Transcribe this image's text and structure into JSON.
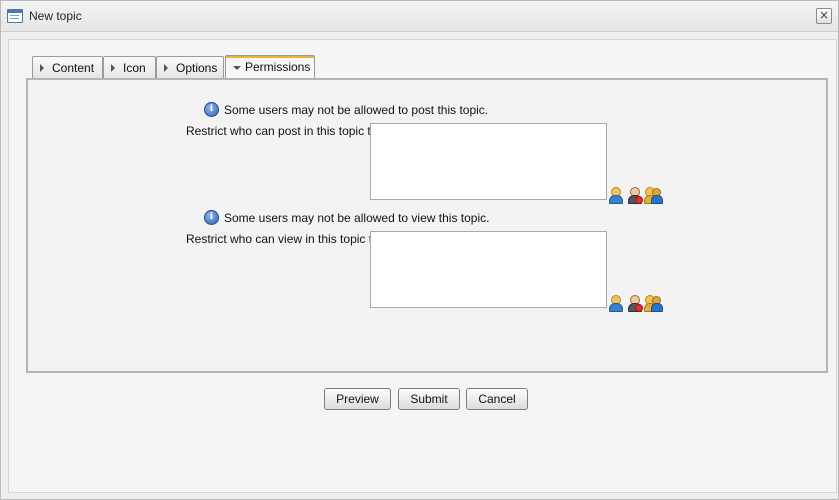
{
  "window": {
    "title": "New topic",
    "close_icon": "×"
  },
  "tabs": [
    {
      "label": "Content",
      "active": false
    },
    {
      "label": "Icon",
      "active": false
    },
    {
      "label": "Options",
      "active": false
    },
    {
      "label": "Permissions",
      "active": true
    }
  ],
  "permissions": {
    "post": {
      "info": "Some users may not be allowed to post this topic.",
      "label": "Restrict who can post in this topic to",
      "value": ""
    },
    "view": {
      "info": "Some users may not be allowed to view this topic.",
      "label": "Restrict who can view in this topic to",
      "value": ""
    }
  },
  "buttons": {
    "preview": "Preview",
    "submit": "Submit",
    "cancel": "Cancel"
  },
  "colors": {
    "active_tab_accent": "#f0b23c",
    "info_icon": "#2f62b2"
  }
}
